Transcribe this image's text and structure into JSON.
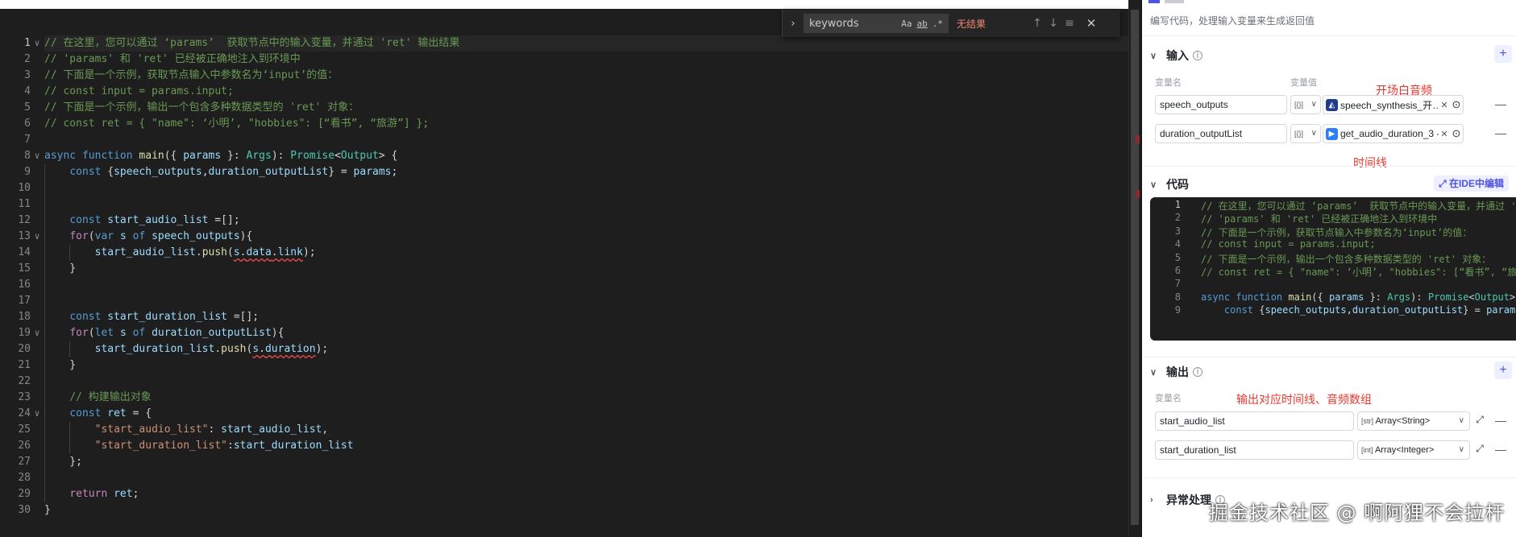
{
  "editor": {
    "find": {
      "value": "keywords",
      "match_case": "Aa",
      "whole_word": "ab",
      "regex": ".*",
      "result": "无结果",
      "prev_icon": "arrow-up",
      "next_icon": "arrow-down",
      "selection_icon": "lines",
      "close_icon": "close"
    },
    "lines": [
      {
        "n": "1",
        "html": "<span class=\"c-com\">// 在这里，您可以通过 ‘params’  获取节点中的输入变量，并通过 'ret' 输出结果</span>"
      },
      {
        "n": "2",
        "html": "<span class=\"c-com\">// 'params' 和 'ret' 已经被正确地注入到环境中</span>"
      },
      {
        "n": "3",
        "html": "<span class=\"c-com\">// 下面是一个示例，获取节点输入中参数名为‘input’的值：</span>"
      },
      {
        "n": "4",
        "html": "<span class=\"c-com\">// const input = params.input;</span>"
      },
      {
        "n": "5",
        "html": "<span class=\"c-com\">// 下面是一个示例，输出一个包含多种数据类型的 'ret' 对象：</span>"
      },
      {
        "n": "6",
        "html": "<span class=\"c-com\">// const ret = { \"name\": ‘小明’, \"hobbies\": [“看书”, “旅游”] };</span>"
      },
      {
        "n": "7",
        "html": ""
      },
      {
        "n": "8",
        "html": "<span class=\"c-kw\">async</span> <span class=\"c-kw\">function</span> <span class=\"c-fn\">main</span>({ <span class=\"c-var\">params</span> }: <span class=\"c-typ\">Args</span>): <span class=\"c-typ\">Promise</span>&lt;<span class=\"c-typ\">Output</span>&gt; {"
      },
      {
        "n": "9",
        "html": "    <span class=\"c-kw\">const</span> {<span class=\"c-var\">speech_outputs</span>,<span class=\"c-var\">duration_outputList</span>} = <span class=\"c-var\">params</span>;"
      },
      {
        "n": "10",
        "html": ""
      },
      {
        "n": "11",
        "html": ""
      },
      {
        "n": "12",
        "html": "    <span class=\"c-kw\">const</span> <span class=\"c-var\">start_audio_list</span> =[];"
      },
      {
        "n": "13",
        "html": "    <span class=\"c-ctl\">for</span>(<span class=\"c-kw\">var</span> <span class=\"c-var\">s</span> <span class=\"c-kw\">of</span> <span class=\"c-var\">speech_outputs</span>){"
      },
      {
        "n": "14",
        "html": "        <span class=\"c-var\">start_audio_list</span>.<span class=\"c-fn\">push</span>(<span class=\"squig\"><span class=\"c-var\">s</span>.<span class=\"c-var\">data</span>.<span class=\"c-var\">link</span></span>);"
      },
      {
        "n": "15",
        "html": "    }"
      },
      {
        "n": "16",
        "html": ""
      },
      {
        "n": "17",
        "html": ""
      },
      {
        "n": "18",
        "html": "    <span class=\"c-kw\">const</span> <span class=\"c-var\">start_duration_list</span> =[];"
      },
      {
        "n": "19",
        "html": "    <span class=\"c-ctl\">for</span>(<span class=\"c-kw\">let</span> <span class=\"c-var\">s</span> <span class=\"c-kw\">of</span> <span class=\"c-var\">duration_outputList</span>){"
      },
      {
        "n": "20",
        "html": "        <span class=\"c-var\">start_duration_list</span>.<span class=\"c-fn\">push</span>(<span class=\"squig\"><span class=\"c-var\">s</span>.<span class=\"c-var\">duration</span></span>);"
      },
      {
        "n": "21",
        "html": "    }"
      },
      {
        "n": "22",
        "html": ""
      },
      {
        "n": "23",
        "html": "    <span class=\"c-com\">// 构建输出对象</span>"
      },
      {
        "n": "24",
        "html": "    <span class=\"c-kw\">const</span> <span class=\"c-var\">ret</span> = {"
      },
      {
        "n": "25",
        "html": "        <span class=\"c-str\">\"start_audio_list\"</span>: <span class=\"c-var\">start_audio_list</span>,"
      },
      {
        "n": "26",
        "html": "        <span class=\"c-str\">\"start_duration_list\"</span>:<span class=\"c-var\">start_duration_list</span>"
      },
      {
        "n": "27",
        "html": "    };"
      },
      {
        "n": "28",
        "html": ""
      },
      {
        "n": "29",
        "html": "    <span class=\"c-ctl\">return</span> <span class=\"c-var\">ret</span>;"
      },
      {
        "n": "30",
        "html": "}"
      }
    ]
  },
  "panel": {
    "description": "编写代码，处理输入变量来生成返回值",
    "input": {
      "title": "输入",
      "col_name": "变量名",
      "col_value": "变量值",
      "rows": [
        {
          "name": "speech_outputs",
          "mode": "[{}]",
          "ref": "speech_synthesis_开… - o…",
          "ref_color": "#1f3b8a"
        },
        {
          "name": "duration_outputList",
          "mode": "[{}]",
          "ref": "get_audio_duration_3 - o…",
          "ref_color": "#2d7ff9"
        }
      ]
    },
    "annotations": {
      "opening_audio": "开场白音频",
      "timeline": "时间线",
      "output_note": "输出对应时间线、音频数组"
    },
    "code": {
      "title": "代码",
      "ide_button": "在IDE中编辑",
      "lines": [
        {
          "n": "1",
          "html": "<span class=\"c-com\">// 在这里，您可以通过 ‘params’  获取节点中的输入变量，并通过 'ret' 输出结果</span>"
        },
        {
          "n": "2",
          "html": "<span class=\"c-com\">// 'params' 和 'ret' 已经被正确地注入到环境中</span>"
        },
        {
          "n": "3",
          "html": "<span class=\"c-com\">// 下面是一个示例，获取节点输入中参数名为‘input’的值：</span>"
        },
        {
          "n": "4",
          "html": "<span class=\"c-com\">// const input = params.input;</span>"
        },
        {
          "n": "5",
          "html": "<span class=\"c-com\">// 下面是一个示例，输出一个包含多种数据类型的 'ret' 对象：</span>"
        },
        {
          "n": "6",
          "html": "<span class=\"c-com\">// const ret = { \"name\": ‘小明’, \"hobbies\": [“看书”, “旅游”] };</span>"
        },
        {
          "n": "7",
          "html": ""
        },
        {
          "n": "8",
          "html": "<span class=\"c-kw\">async</span> <span class=\"c-kw\">function</span> <span class=\"c-fn\">main</span>({ <span class=\"c-var\">params</span> }: <span class=\"c-typ\">Args</span>): <span class=\"c-typ\">Promise</span>&lt;<span class=\"c-typ\">Output</span>&gt; {"
        },
        {
          "n": "9",
          "html": "    <span class=\"c-kw\">const</span> {<span class=\"c-var\">speech_outputs</span>,<span class=\"c-var\">duration_outputList</span>} = <span class=\"c-var\">params</span>;"
        }
      ]
    },
    "output": {
      "title": "输出",
      "col_name": "变量名",
      "rows": [
        {
          "name": "start_audio_list",
          "type_icon": "[str]",
          "type": "Array<String>"
        },
        {
          "name": "start_duration_list",
          "type_icon": "[int]",
          "type": "Array<Integer>"
        }
      ]
    },
    "error": {
      "title": "异常处理"
    }
  },
  "watermark": "掘金技术社区 @ 啊阿狸不会拉杆"
}
